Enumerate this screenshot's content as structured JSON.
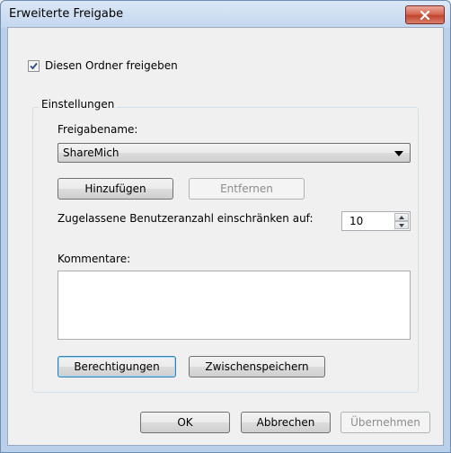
{
  "window": {
    "title": "Erweiterte Freigabe",
    "close_icon": "close-x-icon"
  },
  "share_checkbox": {
    "label": "Diesen Ordner freigeben",
    "checked": true
  },
  "settings": {
    "legend": "Einstellungen",
    "share_name_label": "Freigabename:",
    "share_name_value": "ShareMich",
    "add_button": "Hinzufügen",
    "remove_button": "Entfernen",
    "limit_label": "Zugelassene Benutzeranzahl einschränken auf:",
    "limit_value": "10",
    "comments_label": "Kommentare:",
    "comments_value": "",
    "permissions_button": "Berechtigungen",
    "caching_button": "Zwischenspeichern"
  },
  "footer": {
    "ok": "OK",
    "cancel": "Abbrechen",
    "apply": "Übernehmen"
  }
}
